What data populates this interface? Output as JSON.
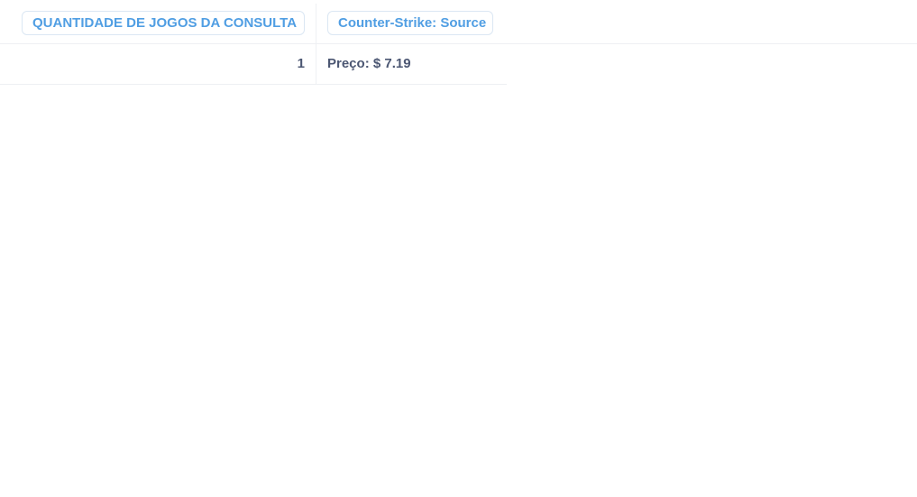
{
  "table": {
    "columns": [
      {
        "label": "QUANTIDADE DE JOGOS DA CONSULTA"
      },
      {
        "label": "Counter-Strike: Source"
      }
    ],
    "rows": [
      {
        "count": "1",
        "price": "Preço: $ 7.19"
      }
    ]
  },
  "colors": {
    "header_text": "#509ee3",
    "cell_text": "#4c5773",
    "border": "#eef0f3"
  }
}
